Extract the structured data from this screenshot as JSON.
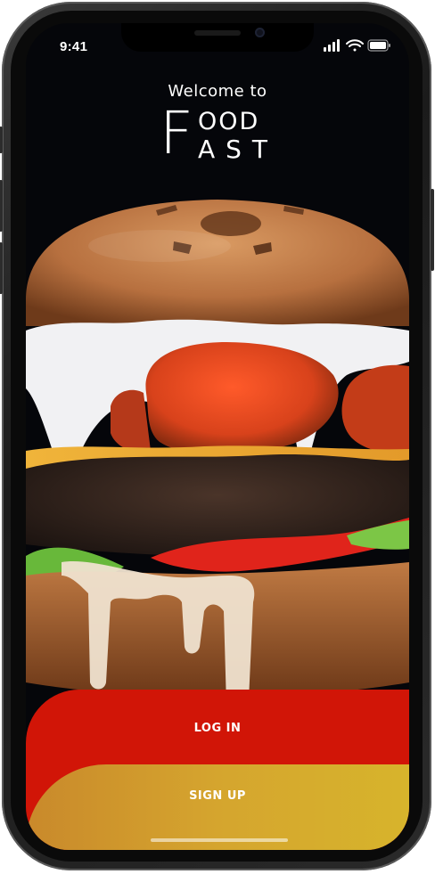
{
  "status_bar": {
    "time": "9:41",
    "icons": [
      "cellular-signal-icon",
      "wifi-icon",
      "battery-icon"
    ]
  },
  "header": {
    "welcome": "Welcome to",
    "logo": {
      "f": "F",
      "top": "OOD",
      "bottom": "AST"
    }
  },
  "hero": {
    "image": "burger-photo"
  },
  "actions": {
    "login_label": "LOG IN",
    "signup_label": "SIGN UP"
  },
  "colors": {
    "login": "#d11507",
    "signup_start": "#c9892b",
    "signup_end": "#d7b42c",
    "background": "#05060a"
  }
}
